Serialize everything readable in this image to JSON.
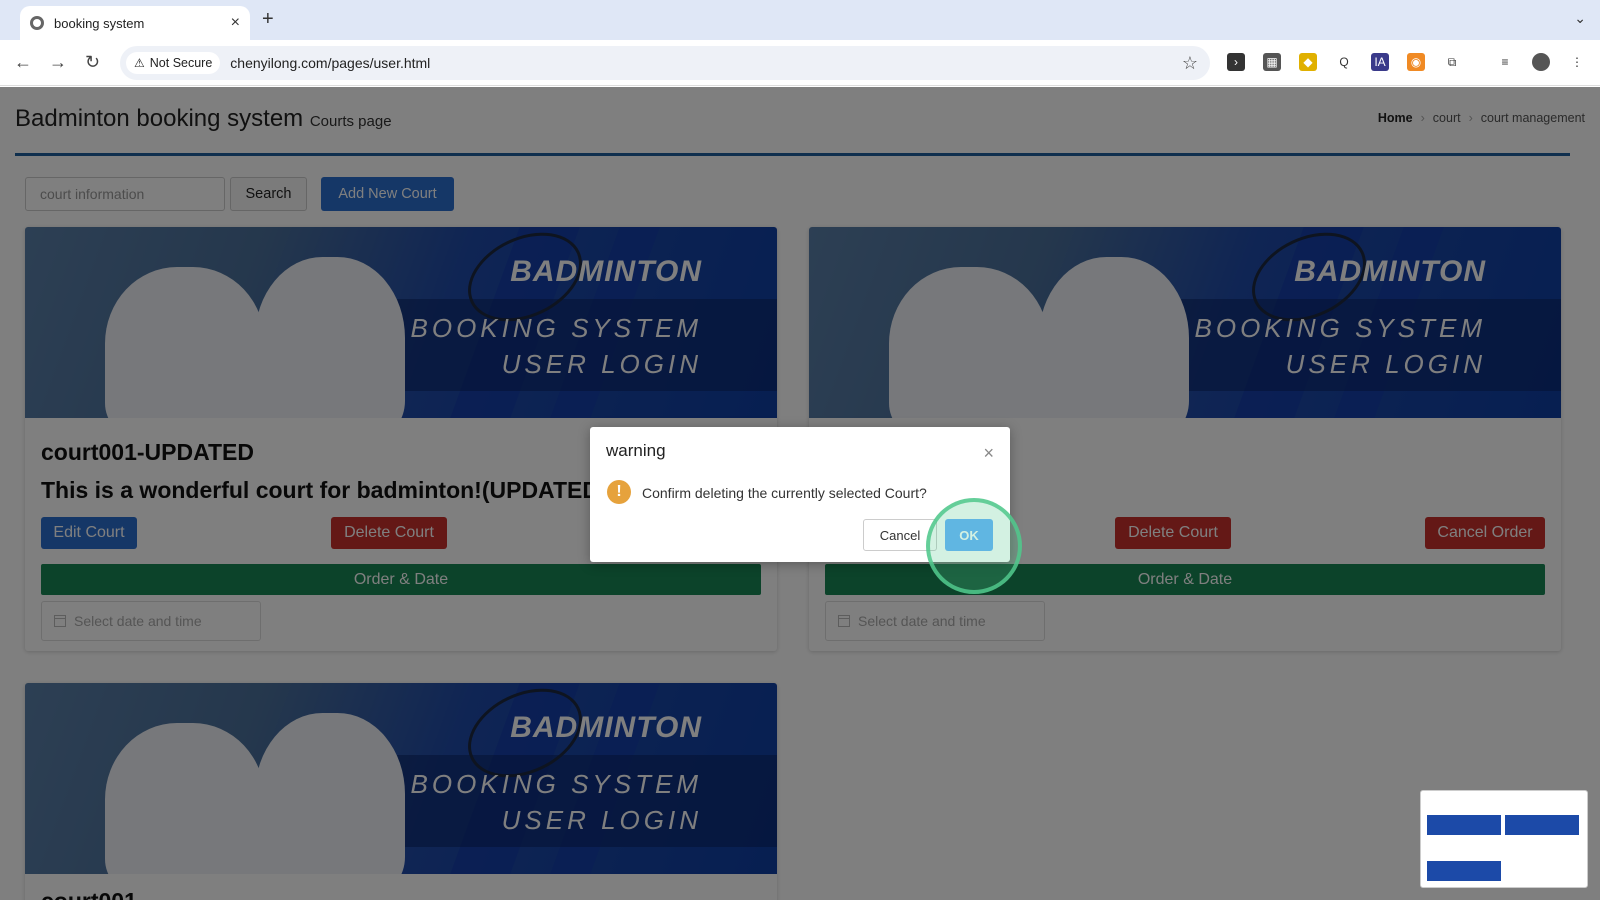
{
  "browser": {
    "tab_title": "booking system",
    "security_label": "Not Secure",
    "url": "chenyilong.com/pages/user.html"
  },
  "header": {
    "title": "Badminton booking system",
    "subtitle": "Courts page",
    "breadcrumb": [
      "Home",
      "court",
      "court management"
    ]
  },
  "toolbar": {
    "search_placeholder": "court information",
    "search_label": "Search",
    "add_label": "Add New Court"
  },
  "banner": {
    "line1": "BADMINTON",
    "line2": "BOOKING SYSTEM",
    "line3": "USER LOGIN"
  },
  "cards": [
    {
      "name": "court001-UPDATED",
      "description": "This is a wonderful court for badminton!(UPDATED",
      "edit_label": "Edit Court",
      "delete_label": "Delete Court",
      "order_label": "Order & Date",
      "date_placeholder": "Select date and time"
    },
    {
      "delete_label": "Delete Court",
      "cancel_order_label": "Cancel Order",
      "order_label": "Order & Date",
      "date_placeholder": "Select date and time"
    },
    {
      "name": "court001"
    }
  ],
  "dialog": {
    "title": "warning",
    "message": "Confirm deleting the currently selected Court?",
    "cancel_label": "Cancel",
    "ok_label": "OK"
  }
}
